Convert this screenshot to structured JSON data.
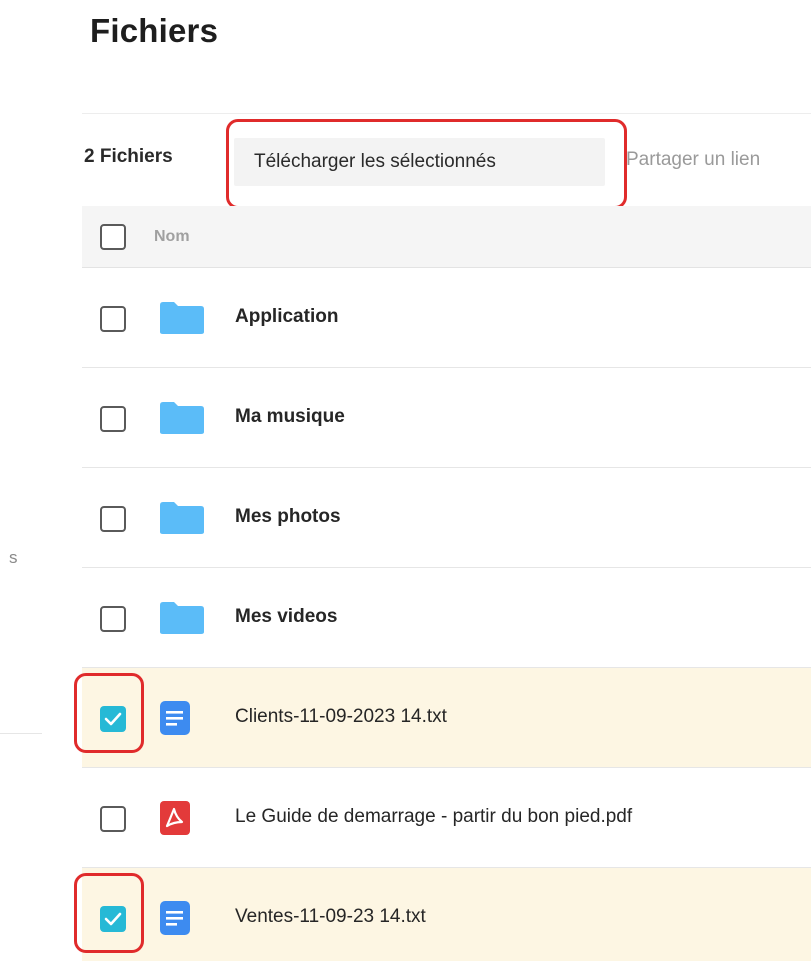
{
  "page": {
    "title": "Fichiers"
  },
  "sidebar": {
    "partial_label": "s"
  },
  "toolbar": {
    "file_count": "2 Fichiers",
    "download_label": "Télécharger les sélectionnés",
    "share_label": "Partager un lien"
  },
  "table": {
    "header": {
      "name_col": "Nom"
    },
    "rows": [
      {
        "name": "Application",
        "kind": "folder",
        "icon": "folder-icon",
        "selected": false
      },
      {
        "name": "Ma musique",
        "kind": "folder",
        "icon": "folder-icon",
        "selected": false
      },
      {
        "name": "Mes photos",
        "kind": "folder",
        "icon": "folder-icon",
        "selected": false
      },
      {
        "name": "Mes videos",
        "kind": "folder",
        "icon": "folder-icon",
        "selected": false
      },
      {
        "name": "Clients-11-09-2023 14.txt",
        "kind": "text-file",
        "icon": "text-file-icon",
        "selected": true
      },
      {
        "name": "Le Guide de demarrage - partir du bon pied.pdf",
        "kind": "pdf-file",
        "icon": "pdf-file-icon",
        "selected": false
      },
      {
        "name": "Ventes-11-09-23 14.txt",
        "kind": "text-file",
        "icon": "text-file-icon",
        "selected": true
      }
    ]
  },
  "colors": {
    "folder": "#5bbcf8",
    "text_file": "#3d8bf0",
    "pdf_file": "#e33a3a",
    "checkbox_checked": "#26b9d6",
    "selected_row_bg": "#fdf6e3",
    "highlight": "#e02b2b"
  }
}
